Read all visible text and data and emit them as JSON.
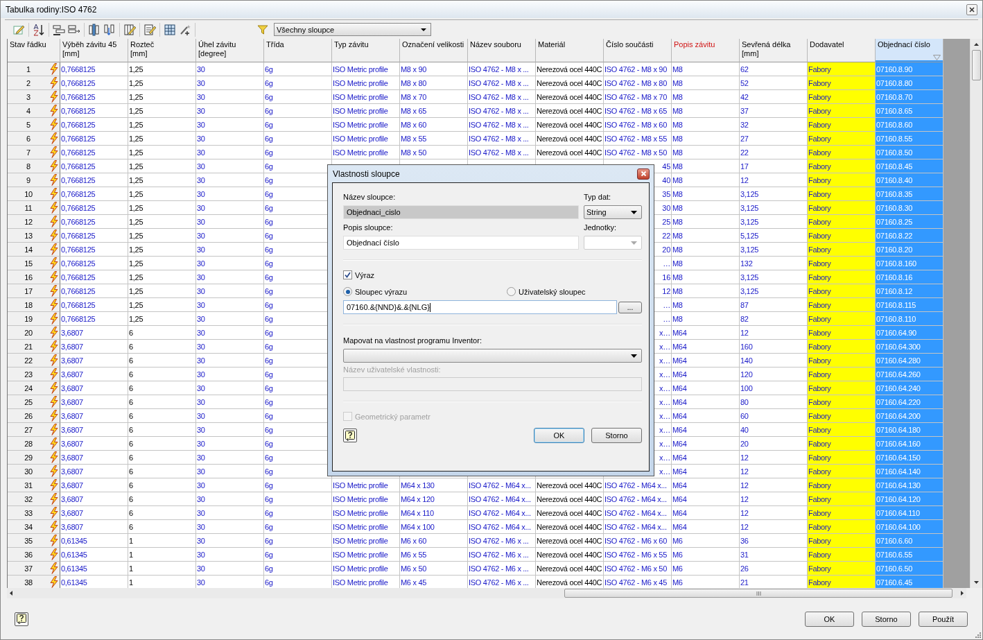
{
  "window": {
    "title": "Tabulka rodiny:ISO 4762"
  },
  "toolbar": {
    "filter": {
      "value": "Všechny sloupce"
    }
  },
  "table": {
    "columns": [
      {
        "label": "Stav řádku",
        "kind": "status",
        "selected": false,
        "sorted": false
      },
      {
        "label": "Výběh závitu 45",
        "unit": "[mm]",
        "kind": "expression",
        "selected": false,
        "sorted": false
      },
      {
        "label": "Rozteč",
        "unit": "[mm]",
        "kind": "value",
        "selected": false,
        "sorted": false
      },
      {
        "label": "Úhel závitu",
        "unit": "[degree]",
        "kind": "expression",
        "selected": false,
        "sorted": false
      },
      {
        "label": "Třída",
        "kind": "expression",
        "selected": false,
        "sorted": false
      },
      {
        "label": "Typ závitu",
        "kind": "expression",
        "selected": false,
        "sorted": false
      },
      {
        "label": "Označení velikosti",
        "kind": "expression",
        "selected": false,
        "sorted": false
      },
      {
        "label": "Název souboru",
        "kind": "expression",
        "selected": false,
        "sorted": false
      },
      {
        "label": "Materiál",
        "kind": "value",
        "selected": false,
        "sorted": false
      },
      {
        "label": "Číslo součásti",
        "kind": "expression",
        "selected": false,
        "sorted": false
      },
      {
        "label": "Popis závitu",
        "kind": "key",
        "selected": false,
        "sorted": false
      },
      {
        "label": "Sevřená délka",
        "unit": "[mm]",
        "kind": "expression",
        "selected": false,
        "sorted": false
      },
      {
        "label": "Dodavatel",
        "kind": "expression",
        "color": "#ffff00",
        "selected": false,
        "sorted": false
      },
      {
        "label": "Objednací číslo",
        "kind": "expression",
        "selected": true,
        "sorted": true
      }
    ],
    "rows": [
      {
        "covered": false,
        "cells": [
          "1",
          "0,7668125",
          "1,25",
          "30",
          "6g",
          "ISO Metric profile",
          "M8 x 90",
          "ISO 4762 - M8 x ...",
          "Nerezová ocel 440C",
          "ISO 4762 - M8 x 90",
          "M8",
          "62",
          "Fabory",
          "07160.8.90"
        ]
      },
      {
        "covered": false,
        "cells": [
          "2",
          "0,7668125",
          "1,25",
          "30",
          "6g",
          "ISO Metric profile",
          "M8 x 80",
          "ISO 4762 - M8 x ...",
          "Nerezová ocel 440C",
          "ISO 4762 - M8 x 80",
          "M8",
          "52",
          "Fabory",
          "07160.8.80"
        ]
      },
      {
        "covered": false,
        "cells": [
          "3",
          "0,7668125",
          "1,25",
          "30",
          "6g",
          "ISO Metric profile",
          "M8 x 70",
          "ISO 4762 - M8 x ...",
          "Nerezová ocel 440C",
          "ISO 4762 - M8 x 70",
          "M8",
          "42",
          "Fabory",
          "07160.8.70"
        ]
      },
      {
        "covered": false,
        "cells": [
          "4",
          "0,7668125",
          "1,25",
          "30",
          "6g",
          "ISO Metric profile",
          "M8 x 65",
          "ISO 4762 - M8 x ...",
          "Nerezová ocel 440C",
          "ISO 4762 - M8 x 65",
          "M8",
          "37",
          "Fabory",
          "07160.8.65"
        ]
      },
      {
        "covered": false,
        "cells": [
          "5",
          "0,7668125",
          "1,25",
          "30",
          "6g",
          "ISO Metric profile",
          "M8 x 60",
          "ISO 4762 - M8 x ...",
          "Nerezová ocel 440C",
          "ISO 4762 - M8 x 60",
          "M8",
          "32",
          "Fabory",
          "07160.8.60"
        ]
      },
      {
        "covered": false,
        "cells": [
          "6",
          "0,7668125",
          "1,25",
          "30",
          "6g",
          "ISO Metric profile",
          "M8 x 55",
          "ISO 4762 - M8 x ...",
          "Nerezová ocel 440C",
          "ISO 4762 - M8 x 55",
          "M8",
          "27",
          "Fabory",
          "07160.8.55"
        ]
      },
      {
        "covered": false,
        "cells": [
          "7",
          "0,7668125",
          "1,25",
          "30",
          "6g",
          "ISO Metric profile",
          "M8 x 50",
          "ISO 4762 - M8 x ...",
          "Nerezová ocel 440C",
          "ISO 4762 - M8 x 50",
          "M8",
          "22",
          "Fabory",
          "07160.8.50"
        ]
      },
      {
        "covered": true,
        "cells": [
          "8",
          "0,7668125",
          "1,25",
          "30",
          "6g",
          null,
          null,
          null,
          null,
          "45",
          "M8",
          "17",
          "Fabory",
          "07160.8.45"
        ]
      },
      {
        "covered": true,
        "cells": [
          "9",
          "0,7668125",
          "1,25",
          "30",
          "6g",
          null,
          null,
          null,
          null,
          "40",
          "M8",
          "12",
          "Fabory",
          "07160.8.40"
        ]
      },
      {
        "covered": true,
        "cells": [
          "10",
          "0,7668125",
          "1,25",
          "30",
          "6g",
          null,
          null,
          null,
          null,
          "35",
          "M8",
          "3,125",
          "Fabory",
          "07160.8.35"
        ]
      },
      {
        "covered": true,
        "cells": [
          "11",
          "0,7668125",
          "1,25",
          "30",
          "6g",
          null,
          null,
          null,
          null,
          "30",
          "M8",
          "3,125",
          "Fabory",
          "07160.8.30"
        ]
      },
      {
        "covered": true,
        "cells": [
          "12",
          "0,7668125",
          "1,25",
          "30",
          "6g",
          null,
          null,
          null,
          null,
          "25",
          "M8",
          "3,125",
          "Fabory",
          "07160.8.25"
        ]
      },
      {
        "covered": true,
        "cells": [
          "13",
          "0,7668125",
          "1,25",
          "30",
          "6g",
          null,
          null,
          null,
          null,
          "22",
          "M8",
          "5,125",
          "Fabory",
          "07160.8.22"
        ]
      },
      {
        "covered": true,
        "cells": [
          "14",
          "0,7668125",
          "1,25",
          "30",
          "6g",
          null,
          null,
          null,
          null,
          "20",
          "M8",
          "3,125",
          "Fabory",
          "07160.8.20"
        ]
      },
      {
        "covered": true,
        "cells": [
          "15",
          "0,7668125",
          "1,25",
          "30",
          "6g",
          null,
          null,
          null,
          null,
          "…",
          "M8",
          "132",
          "Fabory",
          "07160.8.160"
        ]
      },
      {
        "covered": true,
        "cells": [
          "16",
          "0,7668125",
          "1,25",
          "30",
          "6g",
          null,
          null,
          null,
          null,
          "16",
          "M8",
          "3,125",
          "Fabory",
          "07160.8.16"
        ]
      },
      {
        "covered": true,
        "cells": [
          "17",
          "0,7668125",
          "1,25",
          "30",
          "6g",
          null,
          null,
          null,
          null,
          "12",
          "M8",
          "3,125",
          "Fabory",
          "07160.8.12"
        ]
      },
      {
        "covered": true,
        "cells": [
          "18",
          "0,7668125",
          "1,25",
          "30",
          "6g",
          null,
          null,
          null,
          null,
          "…",
          "M8",
          "87",
          "Fabory",
          "07160.8.115"
        ]
      },
      {
        "covered": true,
        "cells": [
          "19",
          "0,7668125",
          "1,25",
          "30",
          "6g",
          null,
          null,
          null,
          null,
          "…",
          "M8",
          "82",
          "Fabory",
          "07160.8.110"
        ]
      },
      {
        "covered": true,
        "cells": [
          "20",
          "3,6807",
          "6",
          "30",
          "6g",
          null,
          null,
          null,
          null,
          "x…",
          "M64",
          "12",
          "Fabory",
          "07160.64.90"
        ]
      },
      {
        "covered": true,
        "cells": [
          "21",
          "3,6807",
          "6",
          "30",
          "6g",
          null,
          null,
          null,
          null,
          "x…",
          "M64",
          "160",
          "Fabory",
          "07160.64.300"
        ]
      },
      {
        "covered": true,
        "cells": [
          "22",
          "3,6807",
          "6",
          "30",
          "6g",
          null,
          null,
          null,
          null,
          "x…",
          "M64",
          "140",
          "Fabory",
          "07160.64.280"
        ]
      },
      {
        "covered": true,
        "cells": [
          "23",
          "3,6807",
          "6",
          "30",
          "6g",
          null,
          null,
          null,
          null,
          "x…",
          "M64",
          "120",
          "Fabory",
          "07160.64.260"
        ]
      },
      {
        "covered": true,
        "cells": [
          "24",
          "3,6807",
          "6",
          "30",
          "6g",
          null,
          null,
          null,
          null,
          "x…",
          "M64",
          "100",
          "Fabory",
          "07160.64.240"
        ]
      },
      {
        "covered": true,
        "cells": [
          "25",
          "3,6807",
          "6",
          "30",
          "6g",
          null,
          null,
          null,
          null,
          "x…",
          "M64",
          "80",
          "Fabory",
          "07160.64.220"
        ]
      },
      {
        "covered": true,
        "cells": [
          "26",
          "3,6807",
          "6",
          "30",
          "6g",
          null,
          null,
          null,
          null,
          "x…",
          "M64",
          "60",
          "Fabory",
          "07160.64.200"
        ]
      },
      {
        "covered": true,
        "cells": [
          "27",
          "3,6807",
          "6",
          "30",
          "6g",
          null,
          null,
          null,
          null,
          "x…",
          "M64",
          "40",
          "Fabory",
          "07160.64.180"
        ]
      },
      {
        "covered": true,
        "cells": [
          "28",
          "3,6807",
          "6",
          "30",
          "6g",
          null,
          null,
          null,
          null,
          "x…",
          "M64",
          "20",
          "Fabory",
          "07160.64.160"
        ]
      },
      {
        "covered": true,
        "cells": [
          "29",
          "3,6807",
          "6",
          "30",
          "6g",
          null,
          null,
          null,
          null,
          "x…",
          "M64",
          "12",
          "Fabory",
          "07160.64.150"
        ]
      },
      {
        "covered": true,
        "cells": [
          "30",
          "3,6807",
          "6",
          "30",
          "6g",
          null,
          null,
          null,
          null,
          "x…",
          "M64",
          "12",
          "Fabory",
          "07160.64.140"
        ]
      },
      {
        "covered": false,
        "cells": [
          "31",
          "3,6807",
          "6",
          "30",
          "6g",
          "ISO Metric profile",
          "M64 x 130",
          "ISO 4762 - M64 x...",
          "Nerezová ocel 440C",
          "ISO 4762 - M64 x...",
          "M64",
          "12",
          "Fabory",
          "07160.64.130"
        ]
      },
      {
        "covered": false,
        "cells": [
          "32",
          "3,6807",
          "6",
          "30",
          "6g",
          "ISO Metric profile",
          "M64 x 120",
          "ISO 4762 - M64 x...",
          "Nerezová ocel 440C",
          "ISO 4762 - M64 x...",
          "M64",
          "12",
          "Fabory",
          "07160.64.120"
        ]
      },
      {
        "covered": false,
        "cells": [
          "33",
          "3,6807",
          "6",
          "30",
          "6g",
          "ISO Metric profile",
          "M64 x 110",
          "ISO 4762 - M64 x...",
          "Nerezová ocel 440C",
          "ISO 4762 - M64 x...",
          "M64",
          "12",
          "Fabory",
          "07160.64.110"
        ]
      },
      {
        "covered": false,
        "cells": [
          "34",
          "3,6807",
          "6",
          "30",
          "6g",
          "ISO Metric profile",
          "M64 x 100",
          "ISO 4762 - M64 x...",
          "Nerezová ocel 440C",
          "ISO 4762 - M64 x...",
          "M64",
          "12",
          "Fabory",
          "07160.64.100"
        ]
      },
      {
        "covered": false,
        "cells": [
          "35",
          "0,61345",
          "1",
          "30",
          "6g",
          "ISO Metric profile",
          "M6 x 60",
          "ISO 4762 - M6 x ...",
          "Nerezová ocel 440C",
          "ISO 4762 - M6 x 60",
          "M6",
          "36",
          "Fabory",
          "07160.6.60"
        ]
      },
      {
        "covered": false,
        "cells": [
          "36",
          "0,61345",
          "1",
          "30",
          "6g",
          "ISO Metric profile",
          "M6 x 55",
          "ISO 4762 - M6 x ...",
          "Nerezová ocel 440C",
          "ISO 4762 - M6 x 55",
          "M6",
          "31",
          "Fabory",
          "07160.6.55"
        ]
      },
      {
        "covered": false,
        "cells": [
          "37",
          "0,61345",
          "1",
          "30",
          "6g",
          "ISO Metric profile",
          "M6 x 50",
          "ISO 4762 - M6 x ...",
          "Nerezová ocel 440C",
          "ISO 4762 - M6 x 50",
          "M6",
          "26",
          "Fabory",
          "07160.6.50"
        ]
      },
      {
        "covered": false,
        "cells": [
          "38",
          "0,61345",
          "1",
          "30",
          "6g",
          "ISO Metric profile",
          "M6 x 45",
          "ISO 4762 - M6 x ...",
          "Nerezová ocel 440C",
          "ISO 4762 - M6 x 45",
          "M6",
          "21",
          "Fabory",
          "07160.6.45"
        ]
      }
    ]
  },
  "buttons": [
    {
      "label": "OK"
    },
    {
      "label": "Storno"
    },
    {
      "label": "Použít"
    }
  ],
  "dialog": {
    "title": "Vlastnosti sloupce",
    "name": {
      "label": "Název sloupce:",
      "value": "Objednaci_cislo",
      "disabled": true
    },
    "data_type": {
      "label": "Typ dat:",
      "value": "String"
    },
    "description": {
      "label": "Popis sloupce:",
      "value": "Objednací číslo"
    },
    "units": {
      "label": "Jednotky:",
      "disabled": true
    },
    "expression": {
      "label": "Výraz",
      "checked": true
    },
    "radios": [
      {
        "label": "Sloupec výrazu",
        "selected": true
      },
      {
        "label": "Uživatelský sloupec",
        "selected": false
      }
    ],
    "expression_value": "07160.&{NND}&.&{NLG}",
    "browse_button": "...",
    "map": {
      "label": "Mapovat na vlastnost programu Inventor:"
    },
    "custom_name": {
      "label": "Název uživatelské vlastnosti:",
      "disabled": true
    },
    "geometric": {
      "label": "Geometrický parametr",
      "checked": false,
      "disabled": true
    },
    "buttons": [
      {
        "label": "OK",
        "default": true
      },
      {
        "label": "Storno",
        "default": false
      }
    ]
  }
}
